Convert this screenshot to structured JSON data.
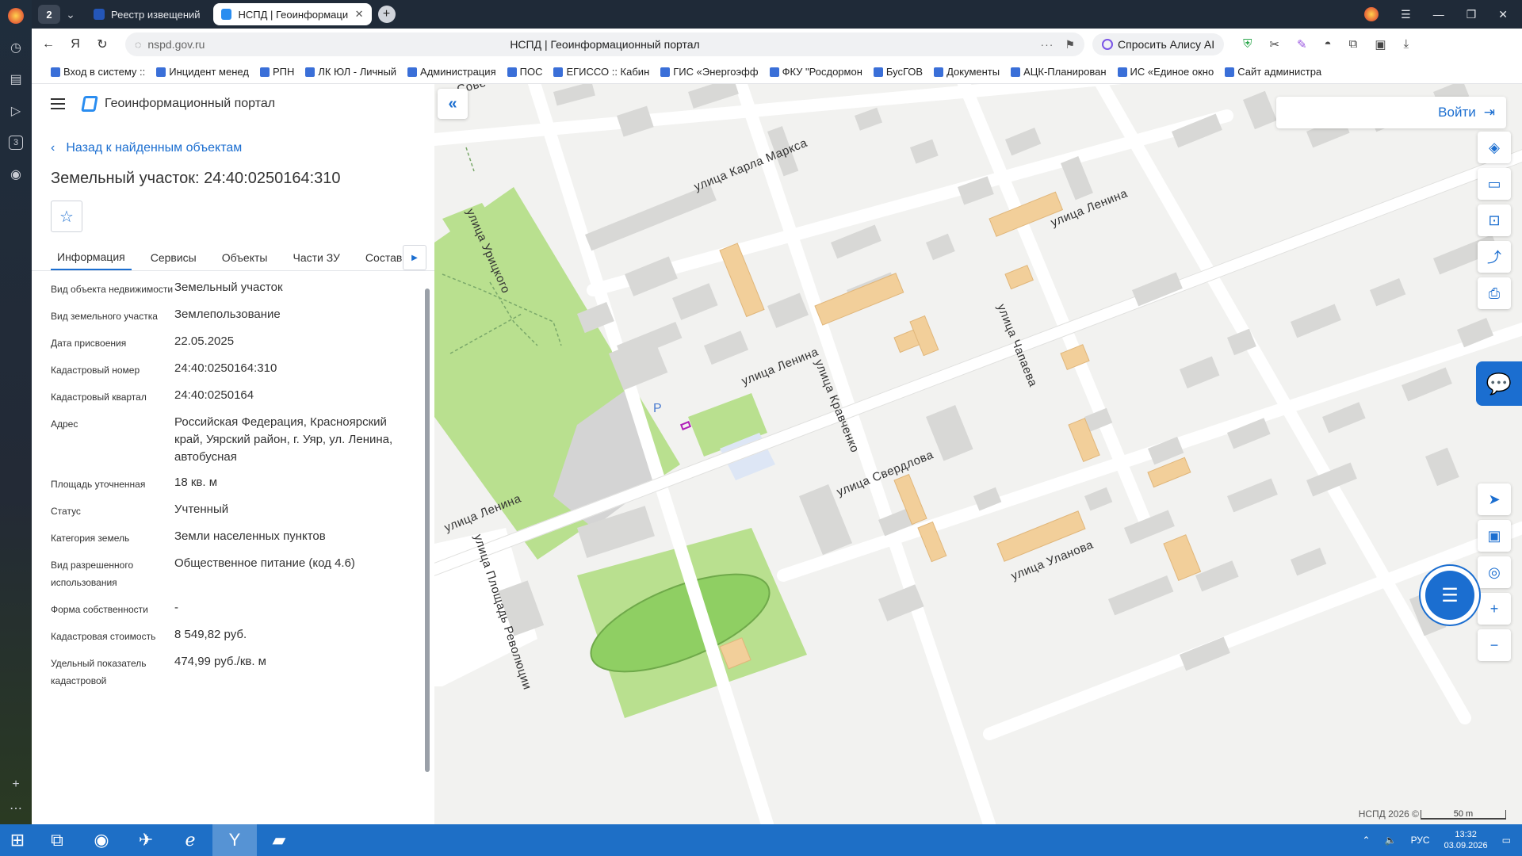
{
  "browser": {
    "tab_count": "2",
    "tabs": [
      {
        "label": "Реестр извещений"
      },
      {
        "label": "НСПД | Геоинформаци"
      }
    ],
    "url": "nspd.gov.ru",
    "page_title": "НСПД | Геоинформационный портал",
    "alice_label": "Спросить Алису AI",
    "bookmarks": [
      "Вход в систему ::",
      "Инцидент менед",
      "РПН",
      "ЛК ЮЛ - Личный",
      "Администрация",
      "ПОС",
      "ЕГИССО :: Кабин",
      "ГИС «Энергоэфф",
      "ФКУ \"Росдормон",
      "БусГОВ",
      "Документы",
      "АЦК-Планирован",
      "ИС «Единое окно",
      "Сайт администра"
    ]
  },
  "side_panel": {
    "brand": "Геоинформационный портал",
    "back_label": "Назад к найденным объектам",
    "title": "Земельный участок: 24:40:0250164:310",
    "tabs": [
      "Информация",
      "Сервисы",
      "Объекты",
      "Части ЗУ",
      "Состав"
    ],
    "active_tab": "Информация",
    "fields": [
      {
        "key": "Вид объекта недвижимости",
        "value": "Земельный участок"
      },
      {
        "key": "Вид земельного участка",
        "value": "Землепользование"
      },
      {
        "key": "Дата присвоения",
        "value": "22.05.2025"
      },
      {
        "key": "Кадастровый номер",
        "value": "24:40:0250164:310"
      },
      {
        "key": "Кадастровый квартал",
        "value": "24:40:0250164"
      },
      {
        "key": "Адрес",
        "value": "Российская Федерация, Красноярский край, Уярский район, г. Уяр, ул. Ленина, автобусная"
      },
      {
        "key": "Площадь уточненная",
        "value": "18 кв. м"
      },
      {
        "key": "Статус",
        "value": "Учтенный"
      },
      {
        "key": "Категория земель",
        "value": "Земли населенных пунктов"
      },
      {
        "key": "Вид разрешенного использования",
        "value": "Общественное питание (код 4.6)"
      },
      {
        "key": "Форма собственности",
        "value": "-"
      },
      {
        "key": "Кадастровая стоимость",
        "value": "8 549,82 руб."
      },
      {
        "key": "Удельный показатель кадастровой",
        "value": "474,99 руб./кв. м"
      }
    ]
  },
  "map": {
    "login_label": "Войти",
    "copyright": "НСПД 2026 ©",
    "scale": "50 m",
    "streets": [
      "Сове",
      "улица Карла Маркса",
      "улица Урицкого",
      "улица Ленина",
      "улица Ленина",
      "улица Ленина",
      "улица Чапаева",
      "улица Кравченко",
      "улица Свердлова",
      "улица Уланова",
      "улица Площадь Революции"
    ],
    "parking_label": "P"
  },
  "taskbar": {
    "lang": "РУС",
    "time": "13:32",
    "date": "03.09.2026"
  },
  "colors": {
    "accent": "#1b6ed0",
    "park": "#b9e08f",
    "building": "#d9d9d9",
    "highlight_building": "#f2cf9a",
    "road": "#ffffff"
  }
}
